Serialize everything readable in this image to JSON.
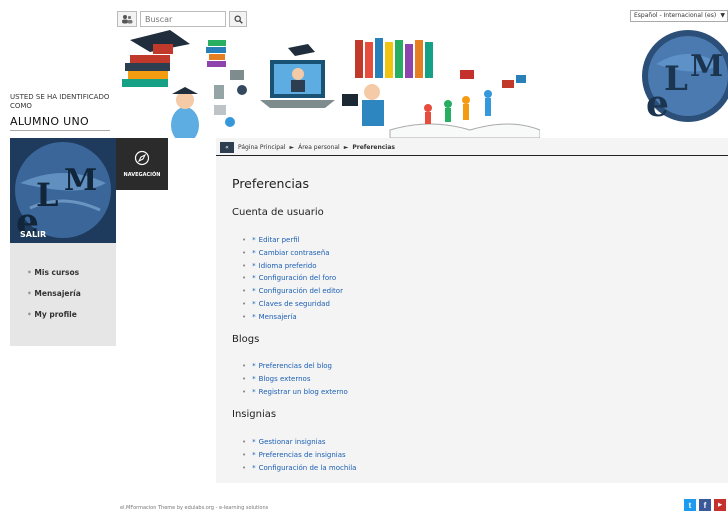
{
  "header": {
    "search_menu_icon": "users-icon",
    "search_placeholder": "Buscar",
    "language": "Español - Internacional (es)"
  },
  "user": {
    "ident": "USTED SE HA IDENTIFICADO COMO",
    "name": "ALUMNO UNO",
    "logout": "SALIR"
  },
  "sidebar": {
    "items": [
      {
        "label": "Mis cursos"
      },
      {
        "label": "Mensajería"
      },
      {
        "label": "My profile"
      }
    ]
  },
  "nav": {
    "label": "NAVEGACIÓN"
  },
  "breadcrumb": {
    "toggle": "«",
    "items": [
      "Página Principal",
      "Área personal",
      "Preferencias"
    ],
    "sep": "►"
  },
  "main": {
    "title": "Preferencias",
    "sections": [
      {
        "title": "Cuenta de usuario",
        "links": [
          "Editar perfil",
          "Cambiar contraseña",
          "Idioma preferido",
          "Configuración del foro",
          "Configuración del editor",
          "Claves de seguridad",
          "Mensajería"
        ]
      },
      {
        "title": "Blogs",
        "links": [
          "Preferencias del blog",
          "Blogs externos",
          "Registrar un blog externo"
        ]
      },
      {
        "title": "Insignias",
        "links": [
          "Gestionar insignias",
          "Preferencias de insignias",
          "Configuración de la mochila"
        ]
      }
    ]
  },
  "footer": {
    "text": "el.MFormacion     Theme by edulabs.org - e-learning solutions"
  },
  "colors": {
    "link": "#1a5fb4",
    "panel": "#e6e6e6",
    "nav": "#2b2b2b",
    "twitter": "#1d9bf0",
    "facebook": "#3b5998",
    "youtube": "#c4302b"
  }
}
